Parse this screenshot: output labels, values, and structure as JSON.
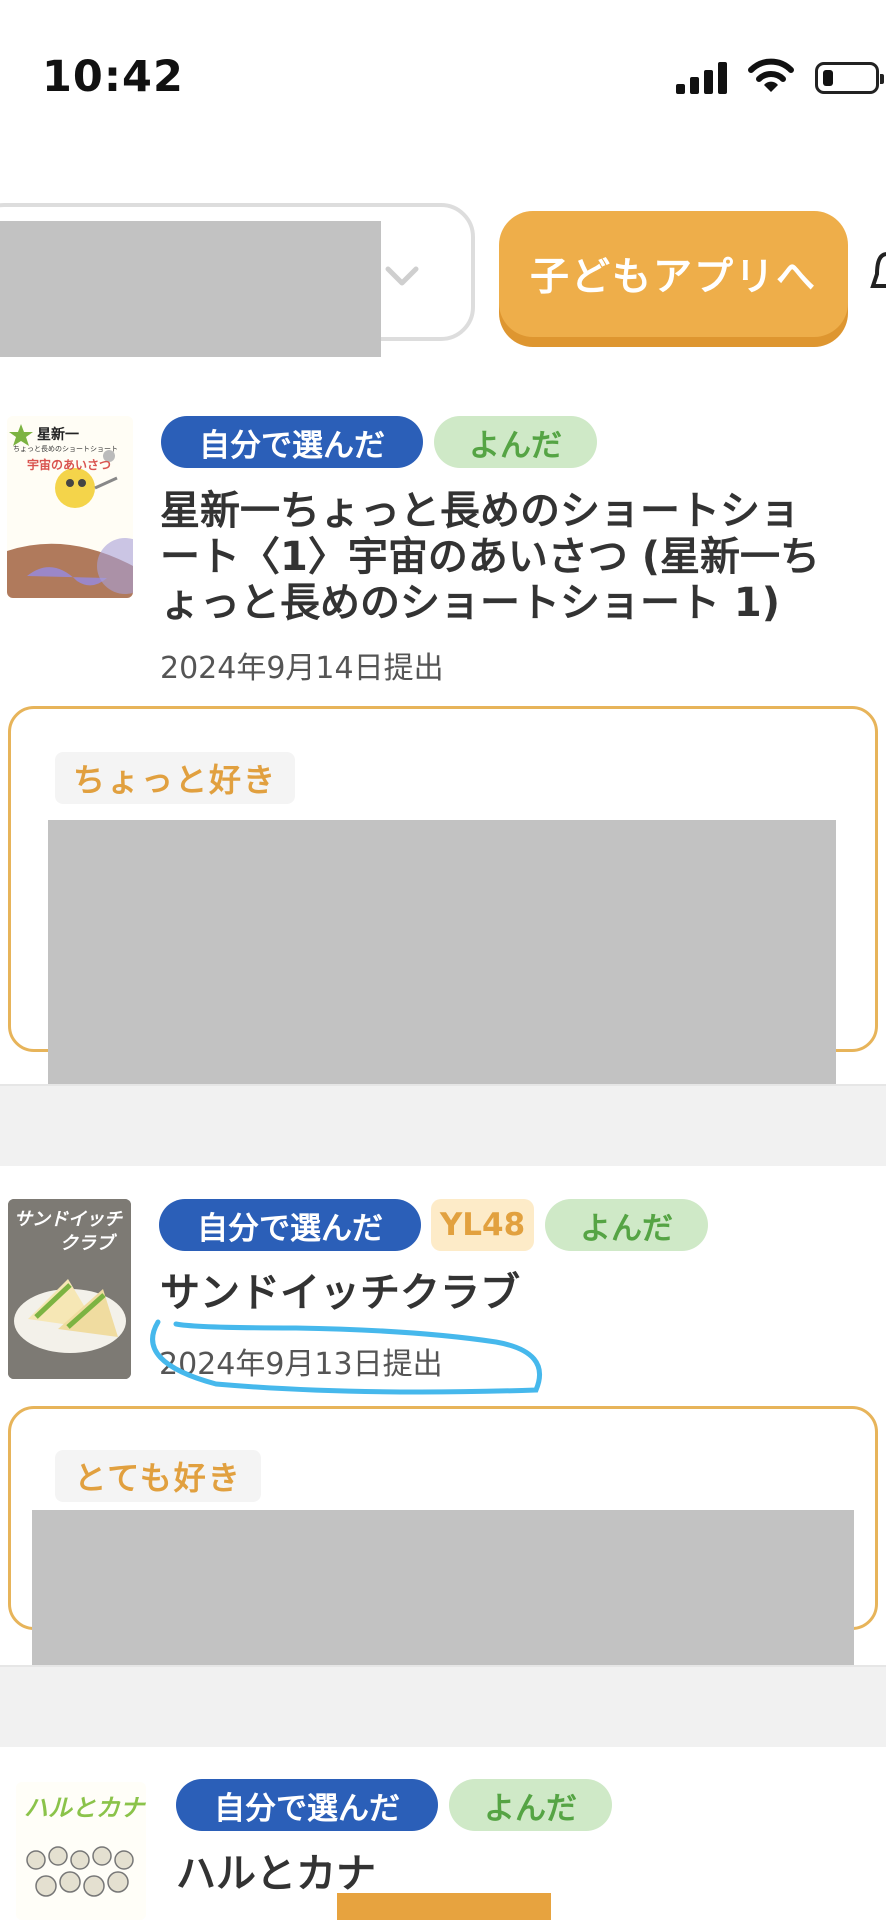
{
  "status_bar": {
    "time": "10:42"
  },
  "header": {
    "child_app_button": "子どもアプリへ"
  },
  "colors": {
    "accent": "#eeae4a",
    "tag_blue": "#2b5fb8",
    "read_green": "#55a444",
    "rating_orange": "#e1a03f",
    "annotation_blue": "#46b8ec"
  },
  "entries": [
    {
      "source_tag": "自分で選んだ",
      "status_tag": "よんだ",
      "title_lines": [
        "星新一ちょっと長めのショートショ",
        "ート〈1〉宇宙のあいさつ (星新一ち",
        "ょっと長めのショートショート 1)"
      ],
      "date": "2024年9月14日提出",
      "rating": "ちょっと好き",
      "cover": {
        "line1": "星新一",
        "line2": "ちょっと長めのショートショート",
        "line3": "宇宙のあいさつ"
      }
    },
    {
      "source_tag": "自分で選んだ",
      "yl_tag": "YL48",
      "status_tag": "よんだ",
      "title": "サンドイッチクラブ",
      "date": "2024年9月13日提出",
      "rating": "とても好き",
      "cover": {
        "line1": "サンドイッチ",
        "line2": "クラブ"
      }
    },
    {
      "source_tag": "自分で選んだ",
      "status_tag": "よんだ",
      "title": "ハルとカナ",
      "cover": {
        "line1": "ハルとカナ"
      }
    }
  ]
}
